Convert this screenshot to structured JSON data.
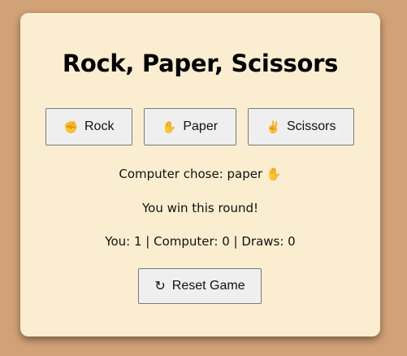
{
  "game": {
    "title": "Rock, Paper, Scissors",
    "choices": [
      {
        "icon": "✊",
        "label": "Rock"
      },
      {
        "icon": "✋",
        "label": "Paper"
      },
      {
        "icon": "✌",
        "label": "Scissors"
      }
    ],
    "computer_choice": "Computer chose: paper ✋",
    "round_result": "You win this round!",
    "score": "You: 1 | Computer: 0 | Draws: 0",
    "reset": {
      "icon": "↻",
      "label": "Reset Game"
    }
  },
  "colors": {
    "background": "#d2a277",
    "card": "#fbeed0",
    "button": "#efefef"
  }
}
